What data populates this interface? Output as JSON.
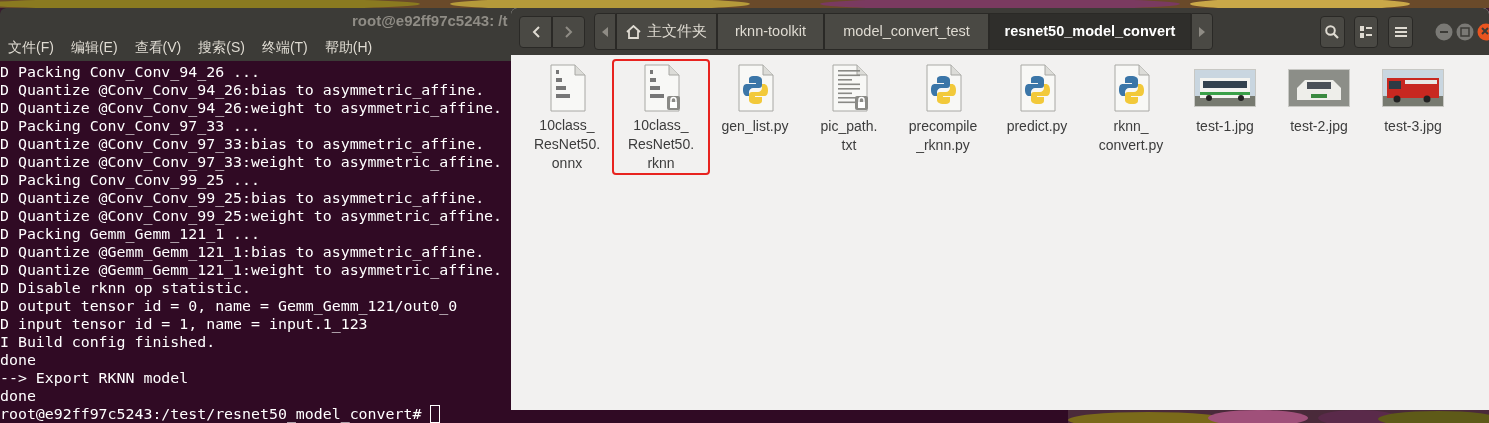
{
  "terminal": {
    "title": "root@e92ff97c5243: /t",
    "menu": [
      "文件(F)",
      "编辑(E)",
      "查看(V)",
      "搜索(S)",
      "终端(T)",
      "帮助(H)"
    ],
    "lines": [
      "D Packing Conv_Conv_94_26 ...",
      "D Quantize @Conv_Conv_94_26:bias to asymmetric_affine.",
      "D Quantize @Conv_Conv_94_26:weight to asymmetric_affine.",
      "D Packing Conv_Conv_97_33 ...",
      "D Quantize @Conv_Conv_97_33:bias to asymmetric_affine.",
      "D Quantize @Conv_Conv_97_33:weight to asymmetric_affine.",
      "D Packing Conv_Conv_99_25 ...",
      "D Quantize @Conv_Conv_99_25:bias to asymmetric_affine.",
      "D Quantize @Conv_Conv_99_25:weight to asymmetric_affine.",
      "D Packing Gemm_Gemm_121_1 ...",
      "D Quantize @Gemm_Gemm_121_1:bias to asymmetric_affine.",
      "D Quantize @Gemm_Gemm_121_1:weight to asymmetric_affine.",
      "D Disable rknn op statistic.",
      "D output tensor id = 0, name = Gemm_Gemm_121/out0_0",
      "D input tensor id = 1, name = input.1_123",
      "I Build config finished.",
      "done",
      "--> Export RKNN model",
      "done"
    ],
    "prompt": "root@e92ff97c5243:/test/resnet50_model_convert#"
  },
  "file_manager": {
    "path": [
      {
        "label": "主文件夹",
        "kind": "home",
        "selected": false
      },
      {
        "label": "rknn-toolkit",
        "kind": "folder",
        "selected": false
      },
      {
        "label": "model_convert_test",
        "kind": "folder",
        "selected": false
      },
      {
        "label": "resnet50_model_convert",
        "kind": "folder",
        "selected": true
      }
    ],
    "items": [
      {
        "kind": "binary",
        "label_lines": [
          "10class_",
          "ResNet50.",
          "onnx"
        ],
        "locked": false,
        "highlighted": false
      },
      {
        "kind": "binary",
        "label_lines": [
          "10class_",
          "ResNet50.",
          "rknn"
        ],
        "locked": true,
        "highlighted": true
      },
      {
        "kind": "python",
        "label_lines": [
          "gen_list.py"
        ],
        "locked": false,
        "highlighted": false
      },
      {
        "kind": "text",
        "label_lines": [
          "pic_path.",
          "txt"
        ],
        "locked": true,
        "highlighted": false
      },
      {
        "kind": "python",
        "label_lines": [
          "precompile",
          "_rknn.py"
        ],
        "locked": false,
        "highlighted": false
      },
      {
        "kind": "python",
        "label_lines": [
          "predict.py"
        ],
        "locked": false,
        "highlighted": false
      },
      {
        "kind": "python",
        "label_lines": [
          "rknn_",
          "convert.py"
        ],
        "locked": false,
        "highlighted": false
      },
      {
        "label_lines": [
          "test-1.jpg"
        ],
        "locked": false,
        "highlighted": false
      },
      {
        "label_lines": [
          "test-2.jpg"
        ],
        "locked": false,
        "highlighted": false
      },
      {
        "label_lines": [
          "test-3.jpg"
        ],
        "locked": false,
        "highlighted": false
      }
    ]
  }
}
